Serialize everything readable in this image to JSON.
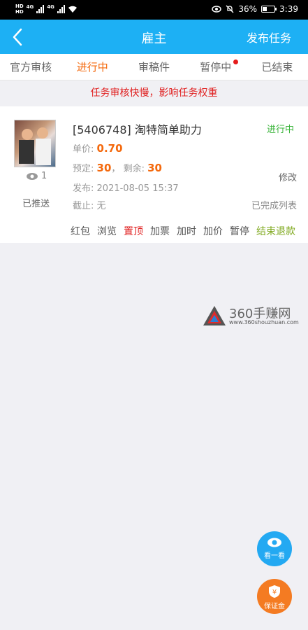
{
  "status_bar": {
    "sim_top": "HD",
    "sim_bottom": "HD",
    "network1": "4G",
    "network2": "4G",
    "battery_percent": "36%",
    "time": "3:39"
  },
  "nav": {
    "title": "雇主",
    "action": "发布任务"
  },
  "tabs": [
    {
      "label": "官方审核",
      "active": false
    },
    {
      "label": "进行中",
      "active": true
    },
    {
      "label": "审稿件",
      "active": false
    },
    {
      "label": "暂停中",
      "active": false,
      "badge": true
    },
    {
      "label": "已结束",
      "active": false
    }
  ],
  "notice": "任务审核快慢，影响任务权重",
  "task": {
    "title": "[5406748] 淘特简单助力",
    "status": "进行中",
    "price_label": "单价:",
    "price": "0.70",
    "reserved_label": "预定:",
    "reserved": "30",
    "separator": "，",
    "remaining_label": "剩余:",
    "remaining": "30",
    "published_label": "发布:",
    "published": "2021-08-05 15:37",
    "deadline_label": "截止:",
    "deadline": "无",
    "views": "1",
    "pushed": "已推送",
    "modify": "修改",
    "completed_list": "已完成列表",
    "actions": [
      "红包",
      "浏览",
      "置顶",
      "加票",
      "加时",
      "加价",
      "暂停",
      "结束退款"
    ]
  },
  "watermark": {
    "name": "360手赚网",
    "url": "www.360shouzhuan.com"
  },
  "fabs": {
    "look": "看一看",
    "deposit": "保证金"
  },
  "colors": {
    "brand_blue": "#1db0f4",
    "accent_orange": "#f4690d",
    "notice_red": "#e02020",
    "status_green": "#3ab43a"
  }
}
